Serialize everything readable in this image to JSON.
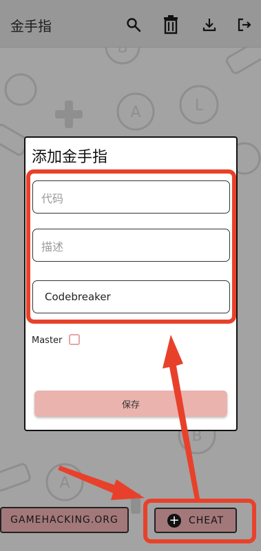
{
  "app": {
    "title": "金手指"
  },
  "toolbar": {
    "icons": [
      "search-icon",
      "trash-icon",
      "download-icon",
      "exit-icon"
    ]
  },
  "dialog": {
    "title": "添加金手指",
    "code_placeholder": "代码",
    "desc_placeholder": "描述",
    "type_value": "Codebreaker",
    "master_label": "Master",
    "master_checked": false,
    "save_label": "保存"
  },
  "bottom": {
    "gamehacking_label": "GAMEHACKING.ORG",
    "cheat_label": "CHEAT"
  },
  "colors": {
    "highlight": "#e8412b",
    "button_bg": "#a3787a",
    "save_bg": "#ebb3ae"
  }
}
